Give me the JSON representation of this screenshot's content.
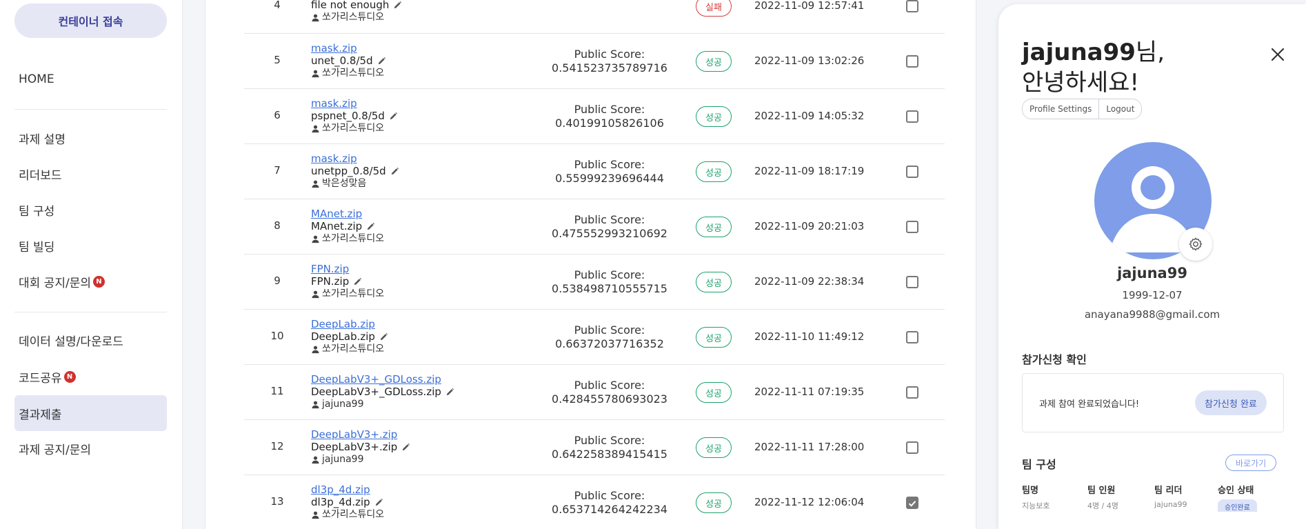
{
  "sidebar": {
    "connect_label": "컨테이너 접속",
    "items": [
      {
        "label": "HOME"
      },
      {
        "label": "과제 설명"
      },
      {
        "label": "리더보드"
      },
      {
        "label": "팀 구성"
      },
      {
        "label": "팀 빌딩"
      },
      {
        "label": "대회 공지/문의",
        "badge": "N"
      },
      {
        "label": "데이터 설명/다운로드"
      },
      {
        "label": "코드공유",
        "badge": "N"
      },
      {
        "label": "결과제출",
        "active": true
      },
      {
        "label": "과제 공지/문의"
      }
    ]
  },
  "submissions": {
    "score_prefix": "Public Score:",
    "rows": [
      {
        "num": "4",
        "file_link": "",
        "file_desc": "file not enough",
        "author": "쏘가리스튜디오",
        "score": "",
        "status": "실패",
        "status_type": "fail",
        "date": "2022-11-09 12:57:41",
        "checked": false
      },
      {
        "num": "5",
        "file_link": "mask.zip",
        "file_desc": "unet_0.8/5d",
        "author": "쏘가리스튜디오",
        "score": "0.541523735789716",
        "status": "성공",
        "status_type": "success",
        "date": "2022-11-09 13:02:26",
        "checked": false
      },
      {
        "num": "6",
        "file_link": "mask.zip",
        "file_desc": "pspnet_0.8/5d",
        "author": "쏘가리스튜디오",
        "score": "0.40199105826106",
        "status": "성공",
        "status_type": "success",
        "date": "2022-11-09 14:05:32",
        "checked": false
      },
      {
        "num": "7",
        "file_link": "mask.zip",
        "file_desc": "unetpp_0.8/5d",
        "author": "박은성맞음",
        "score": "0.55999239696444",
        "status": "성공",
        "status_type": "success",
        "date": "2022-11-09 18:17:19",
        "checked": false
      },
      {
        "num": "8",
        "file_link": "MAnet.zip",
        "file_desc": "MAnet.zip",
        "author": "쏘가리스튜디오",
        "score": "0.475552993210692",
        "status": "성공",
        "status_type": "success",
        "date": "2022-11-09 20:21:03",
        "checked": false
      },
      {
        "num": "9",
        "file_link": "FPN.zip",
        "file_desc": "FPN.zip",
        "author": "쏘가리스튜디오",
        "score": "0.538498710555715",
        "status": "성공",
        "status_type": "success",
        "date": "2022-11-09 22:38:34",
        "checked": false
      },
      {
        "num": "10",
        "file_link": "DeepLab.zip",
        "file_desc": "DeepLab.zip",
        "author": "쏘가리스튜디오",
        "score": "0.66372037716352",
        "status": "성공",
        "status_type": "success",
        "date": "2022-11-10 11:49:12",
        "checked": false
      },
      {
        "num": "11",
        "file_link": "DeepLabV3+_GDLoss.zip",
        "file_desc": "DeepLabV3+_GDLoss.zip",
        "author": "jajuna99",
        "score": "0.428455780693023",
        "status": "성공",
        "status_type": "success",
        "date": "2022-11-11 07:19:35",
        "checked": false
      },
      {
        "num": "12",
        "file_link": "DeepLabV3+.zip",
        "file_desc": "DeepLabV3+.zip",
        "author": "jajuna99",
        "score": "0.642258389415415",
        "status": "성공",
        "status_type": "success",
        "date": "2022-11-11 17:28:00",
        "checked": false
      },
      {
        "num": "13",
        "file_link": "dl3p_4d.zip",
        "file_desc": "dl3p_4d.zip",
        "author": "쏘가리스튜디오",
        "score": "0.653714264242234",
        "status": "성공",
        "status_type": "success",
        "date": "2022-11-12 12:06:04",
        "checked": true
      }
    ]
  },
  "profile": {
    "username_highlight": "jajuna99",
    "greet_suffix": "님,",
    "greet_line2": "안녕하세요!",
    "profile_settings_label": "Profile Settings",
    "logout_label": "Logout",
    "name": "jajuna99",
    "birth": "1999-12-07",
    "email": "anayana9988@gmail.com",
    "avatar_color": "#7f9de8",
    "application": {
      "title": "참가신청 확인",
      "message": "과제 참여 완료되었습니다!",
      "button_label": "참가신청 완료"
    },
    "team": {
      "title": "팀 구성",
      "goto_label": "바로가기",
      "columns": [
        {
          "head": "팀명",
          "value": "지능보호"
        },
        {
          "head": "팀 인원",
          "value": "4명 / 4명"
        },
        {
          "head": "팀 리더",
          "value": "jajuna99"
        },
        {
          "head": "승인 상태",
          "value": "승인완료"
        }
      ]
    }
  }
}
